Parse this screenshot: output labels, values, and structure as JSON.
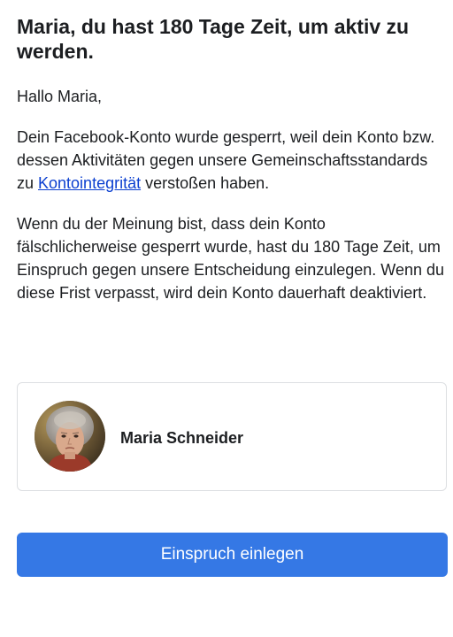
{
  "email": {
    "headline": "Maria, du hast 180 Tage Zeit, um aktiv zu werden.",
    "greeting": "Hallo Maria,",
    "paragraph1": {
      "before_link": "Dein Facebook-Konto wurde gesperrt, weil dein Konto bzw. dessen Aktivitäten gegen unsere Gemeinschaftsstandards zu ",
      "link_text": "Kontointegrität",
      "after_link": " verstoßen haben."
    },
    "paragraph2": "Wenn du der Meinung bist, dass dein Konto fälschlicherweise gesperrt wurde, hast du 180 Tage Zeit, um Einspruch gegen unsere Entscheidung einzulegen. Wenn du diese Frist verpasst, wird dein Konto dauerhaft deaktiviert.",
    "account": {
      "name": "Maria Schneider"
    },
    "cta_label": "Einspruch einlegen"
  },
  "colors": {
    "button": "#3578e5",
    "link": "#0b3fd0",
    "text": "#1c1e21",
    "card_border": "#dddfe2"
  }
}
